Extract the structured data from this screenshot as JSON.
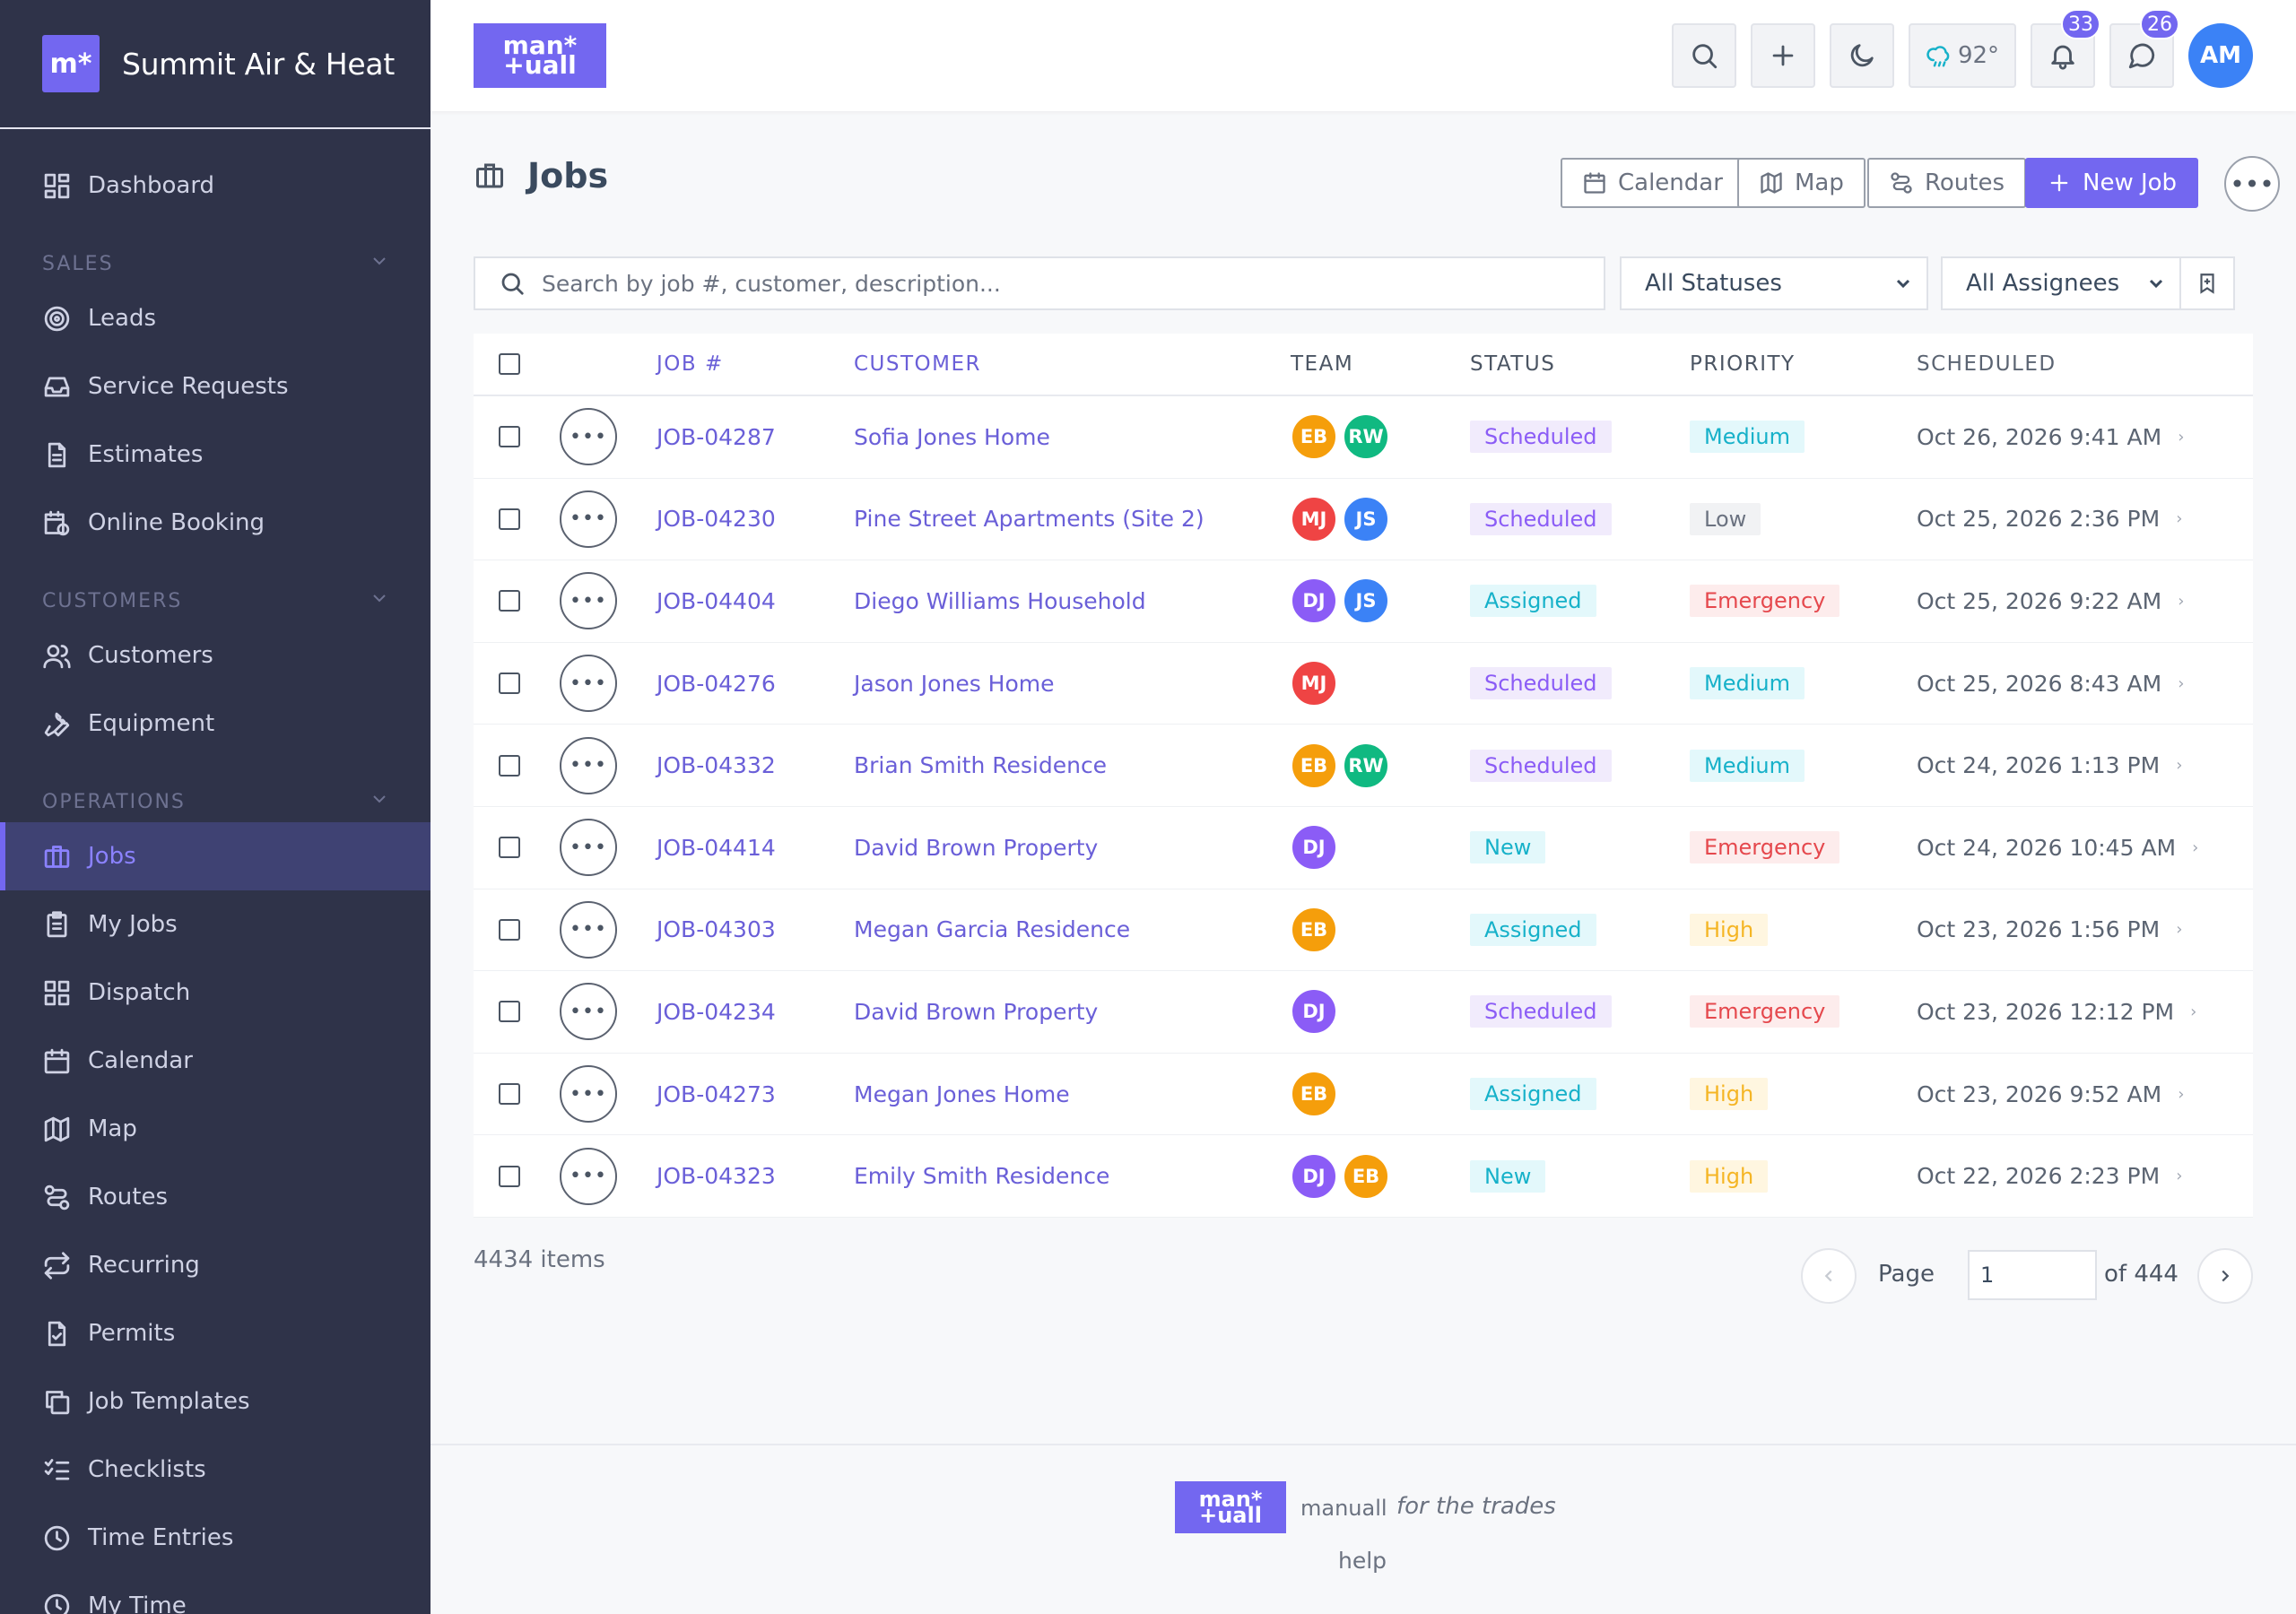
{
  "brand": {
    "logo": "m*",
    "name": "Summit Air & Heat"
  },
  "header_logo": "man*\n+uall",
  "header": {
    "weather": "92°",
    "notifications": "33",
    "messages": "26",
    "avatar": "AM"
  },
  "sidebar": {
    "dashboard": "Dashboard",
    "section_sales": "SALES",
    "leads": "Leads",
    "service_requests": "Service Requests",
    "estimates": "Estimates",
    "online_booking": "Online Booking",
    "section_customers": "CUSTOMERS",
    "customers": "Customers",
    "equipment": "Equipment",
    "section_operations": "OPERATIONS",
    "jobs": "Jobs",
    "my_jobs": "My Jobs",
    "dispatch": "Dispatch",
    "calendar": "Calendar",
    "map": "Map",
    "routes": "Routes",
    "recurring": "Recurring",
    "permits": "Permits",
    "job_templates": "Job Templates",
    "checklists": "Checklists",
    "time_entries": "Time Entries",
    "my_time": "My Time"
  },
  "page": {
    "title": "Jobs",
    "calendar_btn": "Calendar",
    "map_btn": "Map",
    "routes_btn": "Routes",
    "new_job_btn": "New Job",
    "search_placeholder": "Search by job #, customer, description...",
    "status_filter": "All Statuses",
    "assignee_filter": "All Assignees"
  },
  "table": {
    "headers": {
      "job": "JOB #",
      "customer": "CUSTOMER",
      "team": "TEAM",
      "status": "STATUS",
      "priority": "PRIORITY",
      "scheduled": "SCHEDULED"
    },
    "rows": [
      {
        "job": "JOB-04287",
        "customer": "Sofia Jones Home",
        "team": [
          [
            "EB",
            "#f59e0b"
          ],
          [
            "RW",
            "#10b981"
          ]
        ],
        "status": "Scheduled",
        "priority": "Medium",
        "scheduled": "Oct 26, 2026 9:41 AM"
      },
      {
        "job": "JOB-04230",
        "customer": "Pine Street Apartments (Site 2)",
        "team": [
          [
            "MJ",
            "#ef4444"
          ],
          [
            "JS",
            "#3b82f6"
          ]
        ],
        "status": "Scheduled",
        "priority": "Low",
        "scheduled": "Oct 25, 2026 2:36 PM"
      },
      {
        "job": "JOB-04404",
        "customer": "Diego Williams Household",
        "team": [
          [
            "DJ",
            "#8b5cf6"
          ],
          [
            "JS",
            "#3b82f6"
          ]
        ],
        "status": "Assigned",
        "priority": "Emergency",
        "scheduled": "Oct 25, 2026 9:22 AM"
      },
      {
        "job": "JOB-04276",
        "customer": "Jason Jones Home",
        "team": [
          [
            "MJ",
            "#ef4444"
          ]
        ],
        "status": "Scheduled",
        "priority": "Medium",
        "scheduled": "Oct 25, 2026 8:43 AM"
      },
      {
        "job": "JOB-04332",
        "customer": "Brian Smith Residence",
        "team": [
          [
            "EB",
            "#f59e0b"
          ],
          [
            "RW",
            "#10b981"
          ]
        ],
        "status": "Scheduled",
        "priority": "Medium",
        "scheduled": "Oct 24, 2026 1:13 PM"
      },
      {
        "job": "JOB-04414",
        "customer": "David Brown Property",
        "team": [
          [
            "DJ",
            "#8b5cf6"
          ]
        ],
        "status": "New",
        "priority": "Emergency",
        "scheduled": "Oct 24, 2026 10:45 AM"
      },
      {
        "job": "JOB-04303",
        "customer": "Megan Garcia Residence",
        "team": [
          [
            "EB",
            "#f59e0b"
          ]
        ],
        "status": "Assigned",
        "priority": "High",
        "scheduled": "Oct 23, 2026 1:56 PM"
      },
      {
        "job": "JOB-04234",
        "customer": "David Brown Property",
        "team": [
          [
            "DJ",
            "#8b5cf6"
          ]
        ],
        "status": "Scheduled",
        "priority": "Emergency",
        "scheduled": "Oct 23, 2026 12:12 PM"
      },
      {
        "job": "JOB-04273",
        "customer": "Megan Jones Home",
        "team": [
          [
            "EB",
            "#f59e0b"
          ]
        ],
        "status": "Assigned",
        "priority": "High",
        "scheduled": "Oct 23, 2026 9:52 AM"
      },
      {
        "job": "JOB-04323",
        "customer": "Emily Smith Residence",
        "team": [
          [
            "DJ",
            "#8b5cf6"
          ],
          [
            "EB",
            "#f59e0b"
          ]
        ],
        "status": "New",
        "priority": "High",
        "scheduled": "Oct 22, 2026 2:23 PM"
      }
    ]
  },
  "status_colors": {
    "Scheduled": {
      "bg": "#f1ebfc",
      "fg": "#8b5cf6"
    },
    "Assigned": {
      "bg": "#e3f8fb",
      "fg": "#16b1c9"
    },
    "New": {
      "bg": "#e3f8fb",
      "fg": "#16b1c9"
    }
  },
  "priority_colors": {
    "Medium": {
      "bg": "#e3f8fb",
      "fg": "#16b1c9"
    },
    "Low": {
      "bg": "#f1f2f4",
      "fg": "#6b7280"
    },
    "Emergency": {
      "bg": "#fdecec",
      "fg": "#e5484d"
    },
    "High": {
      "bg": "#fff6e0",
      "fg": "#f5b524"
    }
  },
  "pagination": {
    "count": "4434 items",
    "page_label": "Page",
    "page_value": "1",
    "of_label": "of 444"
  },
  "footer": {
    "logo": "man*\n+uall",
    "brand": "manuall",
    "tagline": "for the trades",
    "help": "help"
  }
}
